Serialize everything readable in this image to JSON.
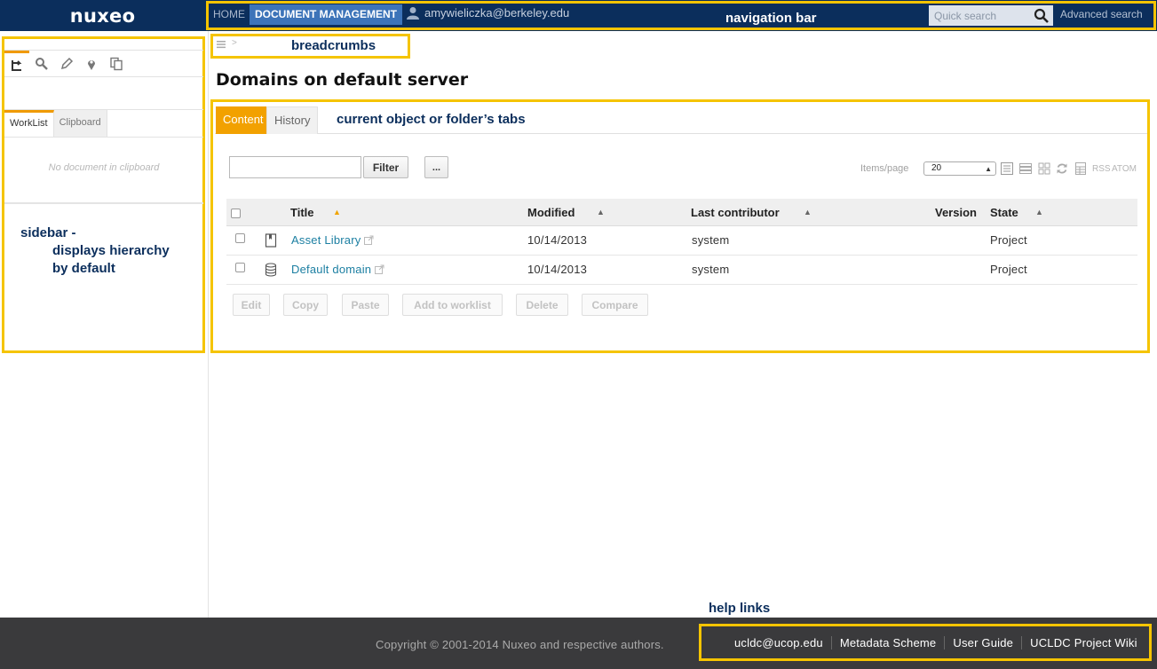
{
  "app": {
    "logo": "nuxeo"
  },
  "nav": {
    "home": "HOME",
    "document_management": "DOCUMENT MANAGEMENT",
    "user": "amywieliczka@berkeley.edu",
    "annotation": "navigation bar",
    "search_placeholder": "Quick search",
    "advanced_search": "Advanced search"
  },
  "sidebar": {
    "icons": [
      "hierarchy-icon",
      "search-icon",
      "pencil-icon",
      "location-pin-icon",
      "copy-icon"
    ],
    "tabs": [
      "WorkList",
      "Clipboard"
    ],
    "empty_message": "No document in clipboard",
    "annotation": [
      "sidebar -",
      "displays hierarchy",
      "by default"
    ]
  },
  "breadcrumb": {
    "separator": ">",
    "annotation": "breadcrumbs"
  },
  "page": {
    "title": "Domains on default server"
  },
  "tabs": {
    "items": [
      "Content",
      "History"
    ],
    "annotation": "current object or folder’s tabs"
  },
  "toolbar": {
    "filter_value": "",
    "filter_button": "Filter",
    "more_button": "...",
    "items_per_page_label": "Items/page",
    "items_per_page_value": "20",
    "rss": "RSS",
    "atom": "ATOM"
  },
  "table": {
    "columns": [
      "Title",
      "Modified",
      "Last contributor",
      "Version",
      "State"
    ],
    "rows": [
      {
        "icon": "book-icon",
        "title": "Asset Library",
        "modified": "10/14/2013",
        "contributor": "system",
        "version": "",
        "state": "Project"
      },
      {
        "icon": "database-icon",
        "title": "Default domain",
        "modified": "10/14/2013",
        "contributor": "system",
        "version": "",
        "state": "Project"
      }
    ]
  },
  "actions": [
    "Edit",
    "Copy",
    "Paste",
    "Add to worklist",
    "Delete",
    "Compare"
  ],
  "footer": {
    "copyright": "Copyright © 2001-2014 Nuxeo and respective authors.",
    "annotation": "help links",
    "links": [
      "ucldc@ucop.edu",
      "Metadata Scheme",
      "User Guide",
      "UCLDC Project Wiki"
    ]
  },
  "colors": {
    "topbar": "#0b2e5c",
    "accent": "#f2a100",
    "annotation_frame": "#f5c400",
    "link": "#1c7fa2",
    "footer": "#3a3a3c"
  }
}
